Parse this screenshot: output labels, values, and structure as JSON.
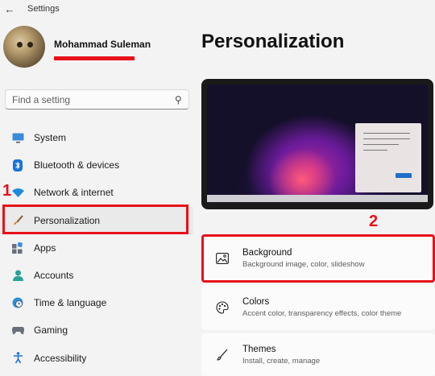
{
  "window": {
    "title": "Settings"
  },
  "profile": {
    "name": "Mohammad Suleman"
  },
  "search": {
    "placeholder": "Find a setting"
  },
  "nav": [
    {
      "label": "System",
      "icon": "monitor-icon"
    },
    {
      "label": "Bluetooth & devices",
      "icon": "bluetooth-icon"
    },
    {
      "label": "Network & internet",
      "icon": "wifi-icon"
    },
    {
      "label": "Personalization",
      "icon": "brush-icon",
      "active": true
    },
    {
      "label": "Apps",
      "icon": "apps-icon"
    },
    {
      "label": "Accounts",
      "icon": "person-icon"
    },
    {
      "label": "Time & language",
      "icon": "globe-clock-icon"
    },
    {
      "label": "Gaming",
      "icon": "gamepad-icon"
    },
    {
      "label": "Accessibility",
      "icon": "accessibility-icon"
    }
  ],
  "annotations": {
    "step1": "1",
    "step2": "2"
  },
  "main": {
    "title": "Personalization",
    "cards": [
      {
        "title": "Background",
        "subtitle": "Background image, color, slideshow",
        "icon": "image-icon"
      },
      {
        "title": "Colors",
        "subtitle": "Accent color, transparency effects, color theme",
        "icon": "palette-icon"
      },
      {
        "title": "Themes",
        "subtitle": "Install, create, manage",
        "icon": "pen-brush-icon"
      }
    ]
  },
  "colors": {
    "accent": "#0067c0",
    "annotation": "#e8101a"
  }
}
